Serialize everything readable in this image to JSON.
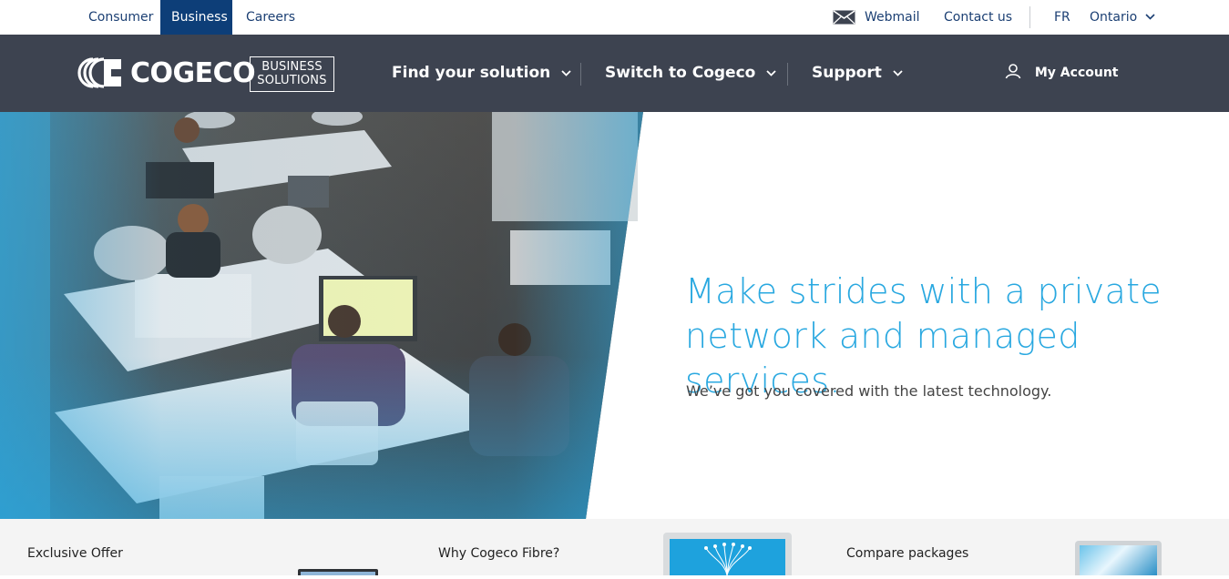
{
  "topbar": {
    "segments": [
      "Consumer",
      "Business",
      "Careers"
    ],
    "active": "Business",
    "webmail": "Webmail",
    "contact": "Contact us",
    "lang": "FR",
    "region": "Ontario"
  },
  "brand": {
    "name": "COGECO",
    "sub_line1": "BUSINESS",
    "sub_line2": "SOLUTIONS"
  },
  "nav": {
    "items": [
      "Find your solution",
      "Switch to Cogeco",
      "Support"
    ],
    "account": "My Account"
  },
  "hero": {
    "title_line1": "Make strides with a private",
    "title_line2": "network and managed services.",
    "subtitle": "We’ve got you covered with the latest technology."
  },
  "cards": [
    {
      "label": "Exclusive Offer"
    },
    {
      "label": "Why Cogeco Fibre?"
    },
    {
      "label": "Compare packages"
    }
  ],
  "colors": {
    "nav_bg": "#3d4350",
    "accent_blue": "#29a8e0",
    "active_tab": "#0d3e78",
    "link": "#1b3f73"
  }
}
